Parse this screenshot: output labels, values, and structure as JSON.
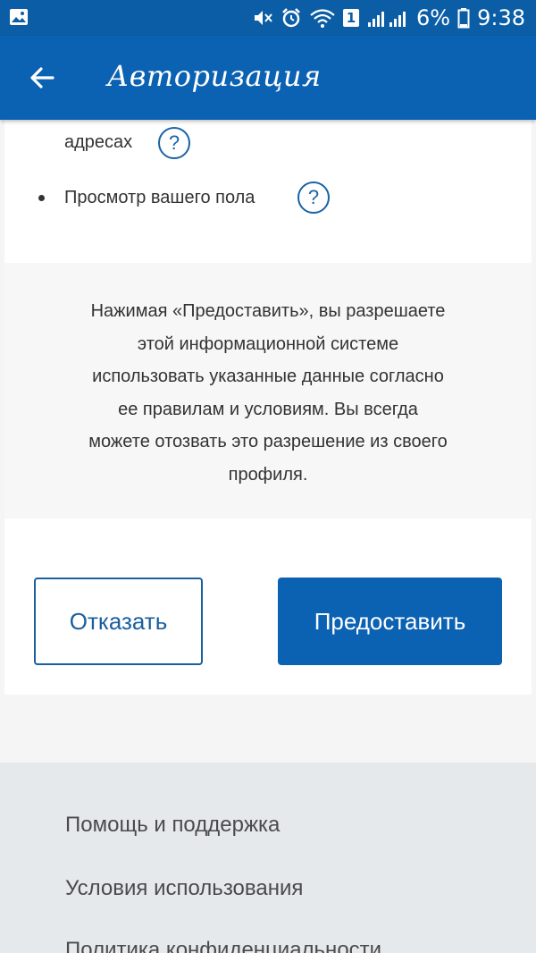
{
  "status_bar": {
    "battery_percent": "6%",
    "time": "9:38",
    "sim_badge": "1",
    "icons": [
      "gallery-icon",
      "mute-icon",
      "alarm-icon",
      "wifi-icon",
      "signal-icon",
      "battery-icon"
    ]
  },
  "app_bar": {
    "title": "Авторизация",
    "back_icon": "arrow-left-icon"
  },
  "permissions": [
    {
      "label": "адресах",
      "show_bullet": false
    },
    {
      "label": "Просмотр вашего пола",
      "show_bullet": true
    }
  ],
  "help_glyph": "?",
  "notice": {
    "lines": [
      "Нажимая «Предоставить», вы разрешаете",
      "этой информационной системе",
      "использовать указанные данные согласно",
      "ее правилам и условиям. Вы всегда",
      "можете отозвать это разрешение из своего",
      "профиля."
    ]
  },
  "buttons": {
    "decline_label": "Отказать",
    "grant_label": "Предоставить"
  },
  "footer": {
    "links": [
      "Помощь и поддержка",
      "Условия использования",
      "Политика конфиденциальности"
    ]
  },
  "colors": {
    "status_bar": "#0b5ea6",
    "app_bar": "#0b62b2",
    "accent": "#1763a8",
    "footer_bg": "#e6e9eb"
  }
}
